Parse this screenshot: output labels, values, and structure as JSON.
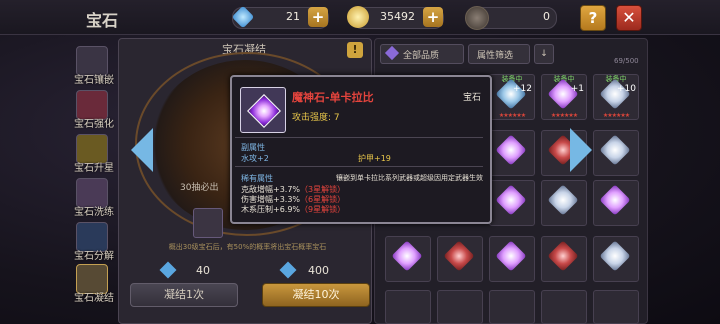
{
  "header": {
    "title": "宝石",
    "diamonds": "21",
    "gold": "35492",
    "tokens": "0",
    "help": "?",
    "close": "✕"
  },
  "nav": [
    {
      "label": "宝石镶嵌"
    },
    {
      "label": "宝石强化"
    },
    {
      "label": "宝石升星"
    },
    {
      "label": "宝石洗练"
    },
    {
      "label": "宝石分解"
    },
    {
      "label": "宝石凝结"
    }
  ],
  "panel": {
    "title": "宝石凝结",
    "pull_text": "30抽必出",
    "hint": "概出30级宝石后，有50%的概率将出宝石概率宝石",
    "cost_once": "40",
    "cost_ten": "400",
    "btn_once": "凝结1次",
    "btn_ten": "凝结10次"
  },
  "inventory": {
    "filter_all": "全部品质",
    "filter_attr": "属性筛选",
    "count": "69/500",
    "equipped_label": "装备中",
    "levels": [
      "+12",
      "+1",
      "+10"
    ]
  },
  "tooltip": {
    "name": "魔神石-单卡拉比",
    "type": "宝石",
    "attack": "攻击强度: 7",
    "sub_header": "副属性",
    "sub_stat1": "水攻+2",
    "sub_stat2": "护甲+19",
    "rare_header": "稀有属性",
    "rare_desc": "镶嵌到单卡拉比系列武器或超级因用定武器生效",
    "rare1": "克敌增幅+3.7%",
    "rare1_lock": "（3星解锁）",
    "rare2": "伤害增幅+3.3%",
    "rare2_lock": "（6星解锁）",
    "rare3": "木系压制+6.9%",
    "rare3_lock": "（9星解锁）"
  },
  "colors": {
    "accent_gold": "#c9973d",
    "rare_red": "#e5443d",
    "stat_yellow": "#e8c64a",
    "link_blue": "#7fb6e4",
    "equip_green": "#7fd36a"
  }
}
